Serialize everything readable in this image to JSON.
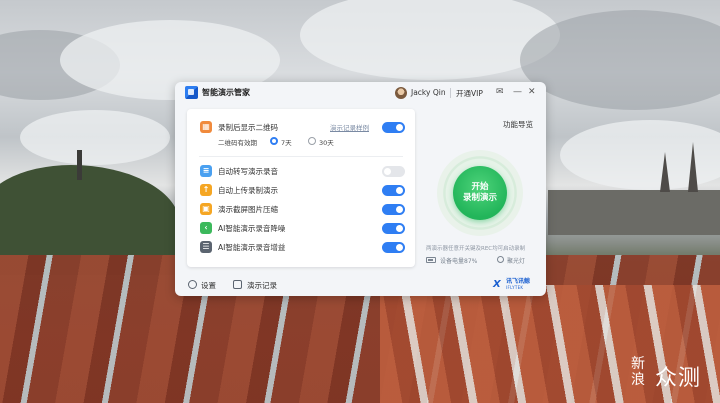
{
  "window": {
    "title": "智能演示管家",
    "user_name": "Jacky Qin",
    "vip_label": "开通VIP",
    "mail_icon": "mail-icon",
    "minimize_icon": "minimize-icon",
    "close_icon": "close-icon"
  },
  "settings": {
    "qr": {
      "label": "录制后显示二维码",
      "link": "演示记录样例",
      "enabled": true,
      "validity_label": "二维码有效期",
      "options": [
        "7天",
        "30天"
      ],
      "selected": "7天"
    },
    "items": [
      {
        "label": "自动转写演示录音",
        "icon": "transcribe-icon",
        "color": "#4aa0f0",
        "enabled": false
      },
      {
        "label": "自动上传录制演示",
        "icon": "upload-icon",
        "color": "#f5a623",
        "enabled": true
      },
      {
        "label": "演示截屏图片压缩",
        "icon": "compress-icon",
        "color": "#f5a623",
        "enabled": true
      },
      {
        "label": "AI智能演示录音降噪",
        "icon": "denoise-icon",
        "color": "#3cb95c",
        "enabled": true
      },
      {
        "label": "AI智能演示录音增益",
        "icon": "gain-icon",
        "color": "#5b6470",
        "enabled": true
      }
    ],
    "qr_icon_color": "#f08a3c"
  },
  "main": {
    "guide_link": "功能导览",
    "record_button": {
      "line1": "开始",
      "line2": "录制演示"
    },
    "hint": "两演示器任意开关键及REC均可启动录制",
    "battery": "设备电量87%",
    "light_label": "聚光灯"
  },
  "footer": {
    "settings_label": "设置",
    "records_label": "演示记录",
    "brand_cn": "讯飞讯鲸",
    "brand_en": "IFLYTEK"
  },
  "watermark": {
    "line1": "新浪",
    "line2": "众测"
  },
  "colors": {
    "accent": "#2f7ef3",
    "record_green": "#22b55a"
  }
}
